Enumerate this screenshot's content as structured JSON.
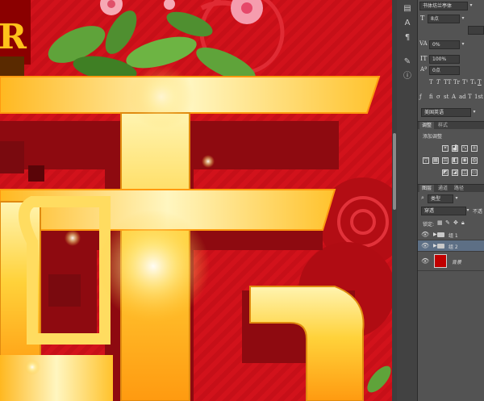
{
  "character": {
    "font_family": "书体坊兰亭体",
    "font_size": "8点",
    "tracking": "0%",
    "vertical_scale": "100%",
    "baseline_shift": "0点",
    "language": "美国英语",
    "style_buttons": [
      "T",
      "T",
      "TT",
      "Tr",
      "T¹",
      "T₁",
      "T",
      "T"
    ],
    "opentype_buttons": [
      "fi",
      "σ",
      "st",
      "A",
      "ad",
      "T",
      "1st",
      "½"
    ]
  },
  "adjustments": {
    "tabs": [
      "调整",
      "样式"
    ],
    "title": "添加调整"
  },
  "layers": {
    "tabs": [
      "图层",
      "通道",
      "路径"
    ],
    "filter_kind": "类型",
    "blend_mode": "穿透",
    "opacity_label": "不透",
    "lock_label": "锁定:",
    "items": [
      {
        "name": "组 1",
        "type": "group"
      },
      {
        "name": "组 2",
        "type": "group"
      },
      {
        "name": "背景",
        "type": "background"
      }
    ]
  },
  "colors": {
    "canvas_red": "#d2121b",
    "gold": "#ffd23a",
    "background_swatch": "#c00000"
  }
}
